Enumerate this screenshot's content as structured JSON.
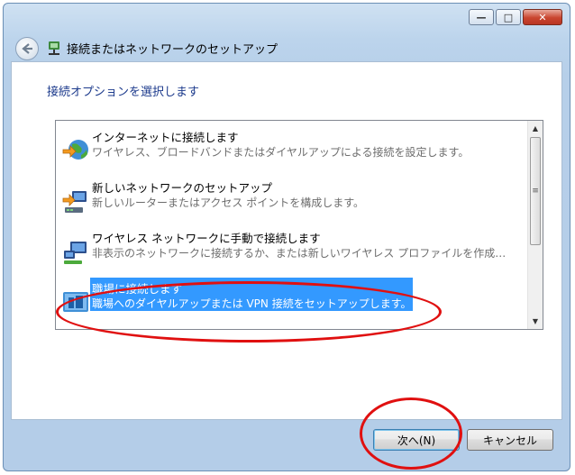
{
  "window": {
    "title": "接続またはネットワークのセットアップ",
    "controls": {
      "minimize": "—",
      "maximize": "□",
      "close": "✕"
    }
  },
  "main": {
    "instruction": "接続オプションを選択します",
    "options": [
      {
        "title": "インターネットに接続します",
        "description": "ワイヤレス、ブロードバンドまたはダイヤルアップによる接続を設定します。",
        "icon": "globe-network-icon",
        "selected": false
      },
      {
        "title": "新しいネットワークのセットアップ",
        "description": "新しいルーターまたはアクセス ポイントを構成します。",
        "icon": "router-icon",
        "selected": false
      },
      {
        "title": "ワイヤレス ネットワークに手動で接続します",
        "description": "非表示のネットワークに接続するか、または新しいワイヤレス プロファイルを作成…",
        "icon": "wireless-network-icon",
        "selected": false
      },
      {
        "title": "職場に接続します",
        "description": "職場へのダイヤルアップまたは VPN 接続をセットアップします。",
        "icon": "workplace-vpn-icon",
        "selected": true
      }
    ],
    "scrollbar": {
      "up": "▲",
      "grip": "≡",
      "down": "▼"
    }
  },
  "footer": {
    "next_label": "次へ(N)",
    "cancel_label": "キャンセル"
  },
  "colors": {
    "selection": "#3399ff",
    "annotation": "#e01010",
    "instruction": "#1c3a8c"
  }
}
